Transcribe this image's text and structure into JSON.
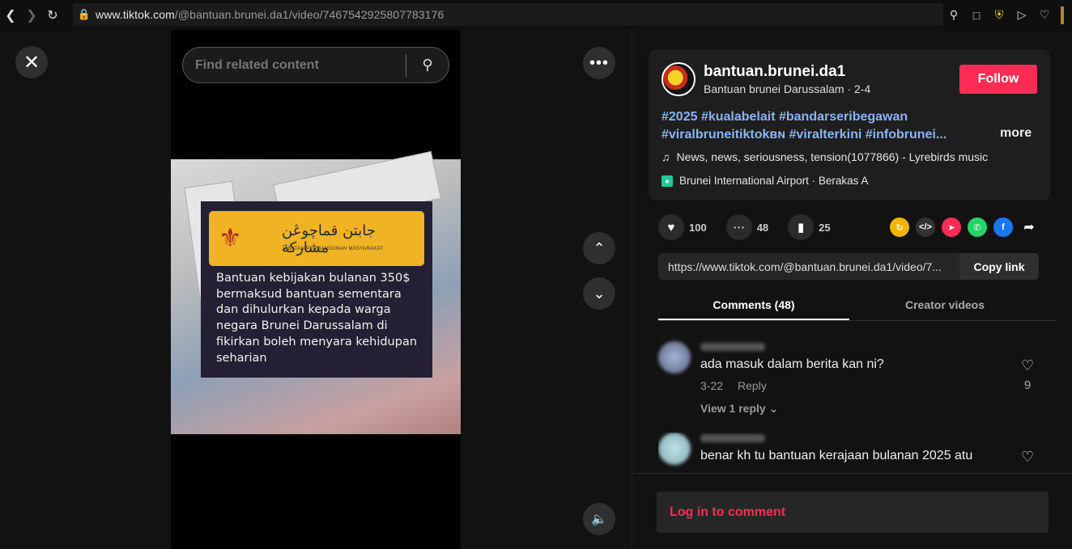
{
  "browser": {
    "url_host": "www.tiktok.com",
    "url_path": "/@bantuan.brunei.da1/video/7467542925807783176"
  },
  "video": {
    "search_placeholder": "Find related content",
    "card_arabic": "جابتن قماچوڠن مشاركة",
    "card_sub": "JABATAN PEMBANGUNAN MASYARAKAT",
    "card_text": "Bantuan kebijakan bulanan 350$ bermaksud bantuan sementara dan dihulurkan kepada warga negara Brunei Darussalam di fikirkan boleh menyara kehidupan seharian"
  },
  "author": {
    "username": "bantuan.brunei.da1",
    "nickname": "Bantuan brunei Darussalam",
    "date": "2-4",
    "follow_label": "Follow"
  },
  "caption": {
    "hashtags_line1": "#2025 #kualabelait #bandarseribegawan",
    "hashtags_line2": "#viralbruneitiktokʙɴ #viralterkini #infobrunei...",
    "more_label": "more"
  },
  "music": "News, news, seriousness, tension(1077866) - Lyrebirds music",
  "location": "Brunei International Airport · Berakas A",
  "actions": {
    "likes": "100",
    "comments": "48",
    "saves": "25"
  },
  "link": {
    "url": "https://www.tiktok.com/@bantuan.brunei.da1/video/7...",
    "copy_label": "Copy link"
  },
  "tabs": {
    "comments": "Comments (48)",
    "creator": "Creator videos"
  },
  "comments": [
    {
      "text": "ada masuk dalam berita kan ni?",
      "date": "3-22",
      "reply_label": "Reply",
      "likes": "9",
      "view_replies": "View 1 reply"
    },
    {
      "text": "benar kh tu bantuan kerajaan bulanan 2025 atu"
    }
  ],
  "login_label": "Log in to comment",
  "colors": {
    "brand": "#fe2c55",
    "hashtag": "#8ab4f8"
  }
}
